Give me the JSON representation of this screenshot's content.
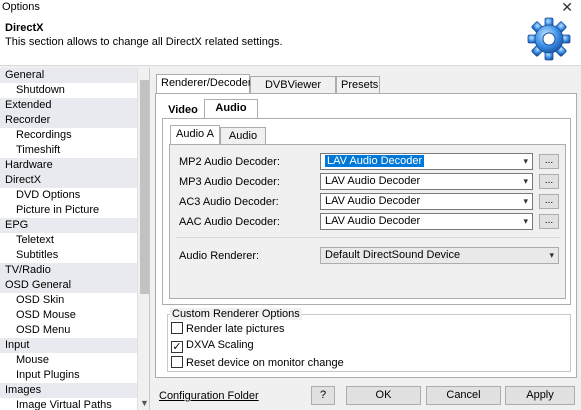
{
  "window": {
    "title": "Options",
    "close_glyph": "✕"
  },
  "header": {
    "title": "DirectX",
    "description": "This section allows to change all DirectX related settings.",
    "icon": "gear-icon"
  },
  "sidebar": {
    "items": [
      {
        "label": "General",
        "level": "category"
      },
      {
        "label": "Shutdown",
        "level": "sub"
      },
      {
        "label": "Extended",
        "level": "category"
      },
      {
        "label": "Recorder",
        "level": "category"
      },
      {
        "label": "Recordings",
        "level": "sub"
      },
      {
        "label": "Timeshift",
        "level": "sub"
      },
      {
        "label": "Hardware",
        "level": "category"
      },
      {
        "label": "DirectX",
        "level": "category"
      },
      {
        "label": "DVD Options",
        "level": "sub"
      },
      {
        "label": "Picture in Picture",
        "level": "sub"
      },
      {
        "label": "EPG",
        "level": "category"
      },
      {
        "label": "Teletext",
        "level": "sub"
      },
      {
        "label": "Subtitles",
        "level": "sub"
      },
      {
        "label": "TV/Radio",
        "level": "category"
      },
      {
        "label": "OSD General",
        "level": "category"
      },
      {
        "label": "OSD Skin",
        "level": "sub"
      },
      {
        "label": "OSD Mouse",
        "level": "sub"
      },
      {
        "label": "OSD Menu",
        "level": "sub"
      },
      {
        "label": "Input",
        "level": "category"
      },
      {
        "label": "Mouse",
        "level": "sub"
      },
      {
        "label": "Input Plugins",
        "level": "sub"
      },
      {
        "label": "Images",
        "level": "category"
      },
      {
        "label": "Image Virtual Paths",
        "level": "sub"
      }
    ]
  },
  "tabs": {
    "top": [
      "Renderer/Decoder",
      "DVBViewer Filter",
      "Presets"
    ],
    "media": [
      "Video",
      "Audio"
    ],
    "audio": [
      "Audio A",
      "Audio B"
    ]
  },
  "decoders": {
    "rows": [
      {
        "label": "MP2 Audio Decoder:",
        "value": "LAV Audio Decoder"
      },
      {
        "label": "MP3 Audio Decoder:",
        "value": "LAV Audio Decoder"
      },
      {
        "label": "AC3 Audio Decoder:",
        "value": "LAV Audio Decoder"
      },
      {
        "label": "AAC Audio Decoder:",
        "value": "LAV Audio Decoder"
      }
    ],
    "dots_label": "...",
    "renderer_label": "Audio Renderer:",
    "renderer_value": "Default DirectSound Device"
  },
  "custom_options": {
    "title": "Custom Renderer Options",
    "checkboxes": [
      {
        "label": "Render late pictures",
        "checked": false
      },
      {
        "label": "DXVA Scaling",
        "checked": true
      },
      {
        "label": "Reset device on monitor change",
        "checked": false
      }
    ]
  },
  "footer": {
    "config_link": "Configuration Folder",
    "help": "?",
    "ok": "OK",
    "cancel": "Cancel",
    "apply": "Apply"
  }
}
